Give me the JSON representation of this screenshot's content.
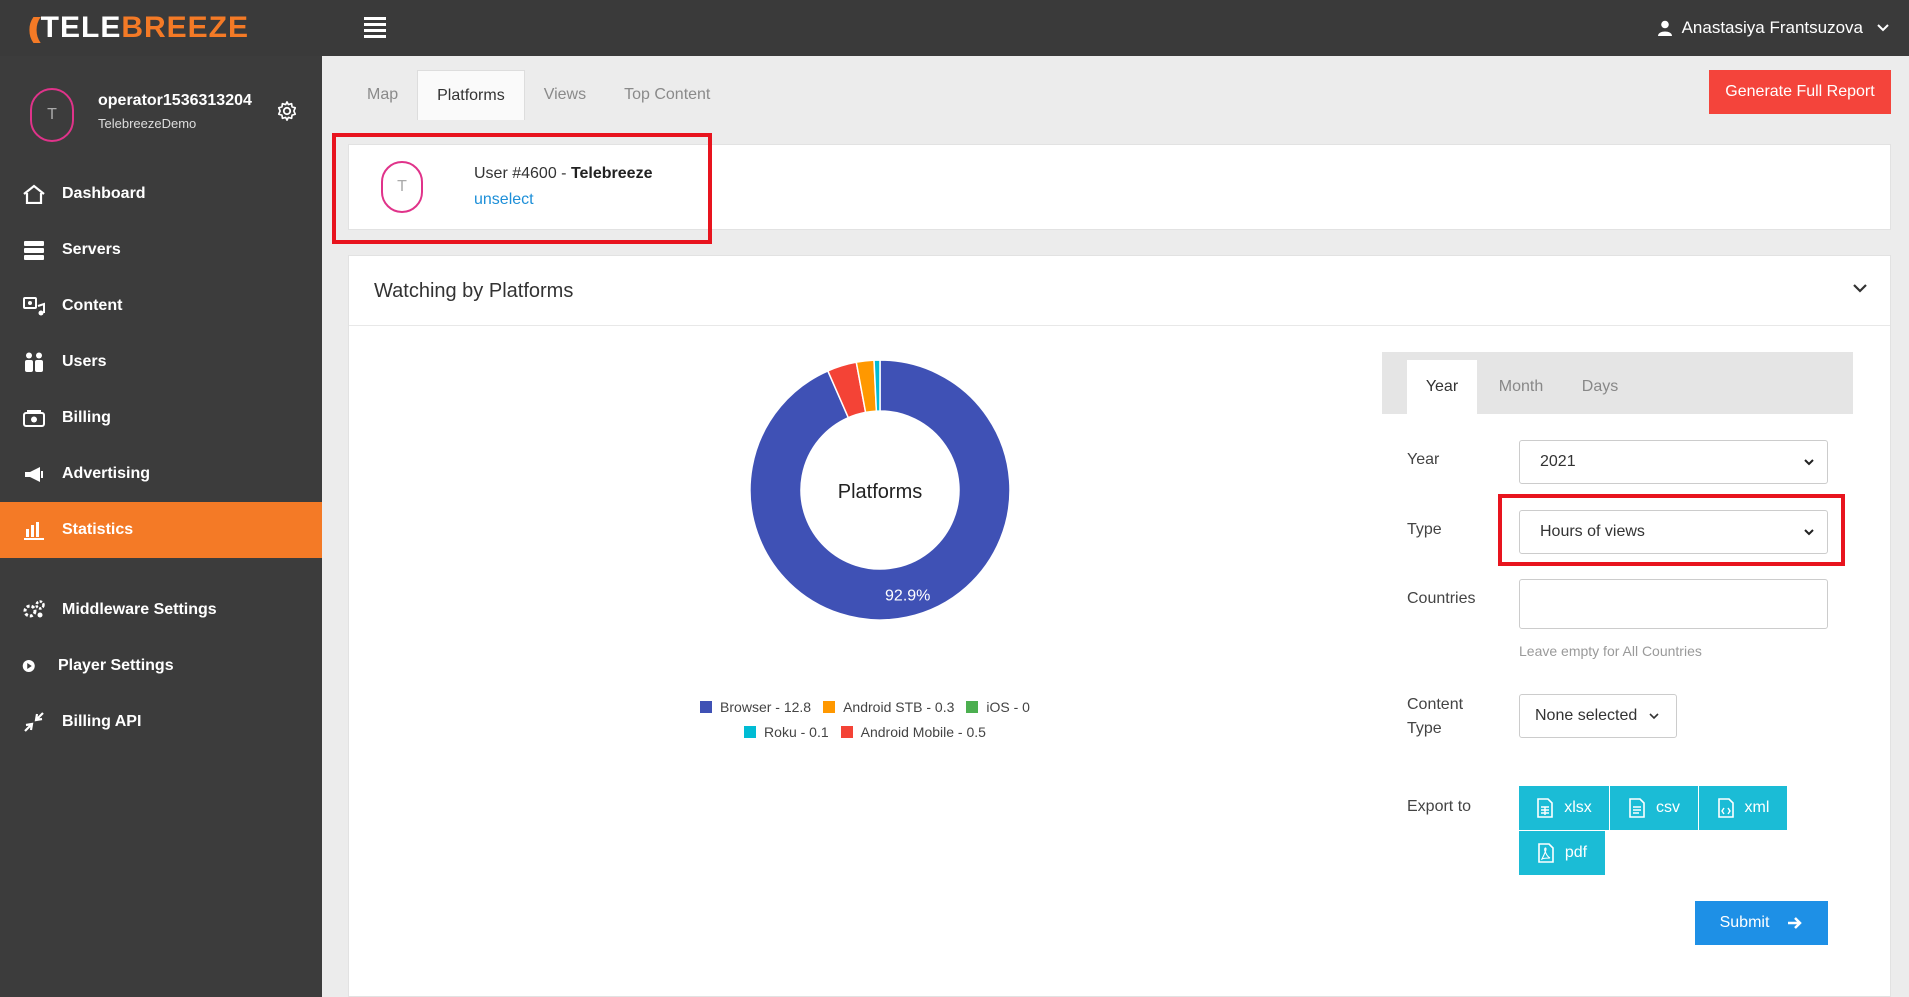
{
  "topbar": {
    "logo_prefix": "((",
    "logo_text_a": "TELE",
    "logo_text_b": "BREEZE",
    "user_name": "Anastasiya Frantsuzova"
  },
  "sidebar": {
    "avatar_initial": "T",
    "operator": "operator1536313204",
    "organization": "TelebreezeDemo",
    "items": [
      {
        "label": "Dashboard",
        "icon": "home-icon"
      },
      {
        "label": "Servers",
        "icon": "servers-icon"
      },
      {
        "label": "Content",
        "icon": "content-icon"
      },
      {
        "label": "Users",
        "icon": "users-icon"
      },
      {
        "label": "Billing",
        "icon": "billing-icon"
      },
      {
        "label": "Advertising",
        "icon": "megaphone-icon"
      },
      {
        "label": "Statistics",
        "icon": "bar-chart-icon",
        "active": true
      },
      {
        "label": "Middleware Settings",
        "icon": "gears-icon"
      },
      {
        "label": "Player Settings",
        "icon": "play-icon"
      },
      {
        "label": "Billing API",
        "icon": "api-arrows-icon"
      }
    ]
  },
  "tabs": [
    {
      "label": "Map"
    },
    {
      "label": "Platforms",
      "active": true
    },
    {
      "label": "Views"
    },
    {
      "label": "Top Content"
    }
  ],
  "report_button": "Generate Full Report",
  "user_card": {
    "avatar_initial": "T",
    "user_prefix": "User #4600 - ",
    "user_name": "Telebreeze",
    "unselect_link": "unselect"
  },
  "panel": {
    "title": "Watching by Platforms"
  },
  "chart_data": {
    "type": "pie",
    "center_label": "Platforms",
    "slices": [
      {
        "name": "Browser",
        "value": 12.8,
        "color": "#3f51b5"
      },
      {
        "name": "Android Mobile",
        "value": 0.5,
        "color": "#f44336"
      },
      {
        "name": "Android STB",
        "value": 0.3,
        "color": "#ff9800"
      },
      {
        "name": "iOS",
        "value": 0,
        "color": "#4caf50"
      },
      {
        "name": "Roku",
        "value": 0.1,
        "color": "#00bcd4"
      }
    ],
    "data_labels": [
      {
        "slice": "Browser",
        "text": "92.9%"
      }
    ],
    "legend": [
      [
        "Browser - 12.8",
        "Android STB - 0.3",
        "iOS - 0"
      ],
      [
        "Roku - 0.1",
        "Android Mobile - 0.5"
      ]
    ],
    "legend_colors": [
      [
        "#3f51b5",
        "#ff9800",
        "#4caf50"
      ],
      [
        "#00bcd4",
        "#f44336"
      ]
    ]
  },
  "filters": {
    "tabs": [
      {
        "label": "Year",
        "active": true
      },
      {
        "label": "Month"
      },
      {
        "label": "Days"
      }
    ],
    "year_label": "Year",
    "year_value": "2021",
    "type_label": "Type",
    "type_value": "Hours of views",
    "countries_label": "Countries",
    "countries_value": "",
    "countries_hint": "Leave empty for All Countries",
    "content_type_label_1": "Content",
    "content_type_label_2": "Type",
    "content_type_value": "None selected",
    "export_label": "Export to",
    "export_buttons": [
      "xlsx",
      "csv",
      "xml",
      "pdf"
    ],
    "submit": "Submit"
  },
  "colors": {
    "accent": "#f47a26",
    "report_button": "#f4443b",
    "export": "#1bbcd6",
    "submit": "#1e90e6",
    "highlight": "#e8141e"
  }
}
